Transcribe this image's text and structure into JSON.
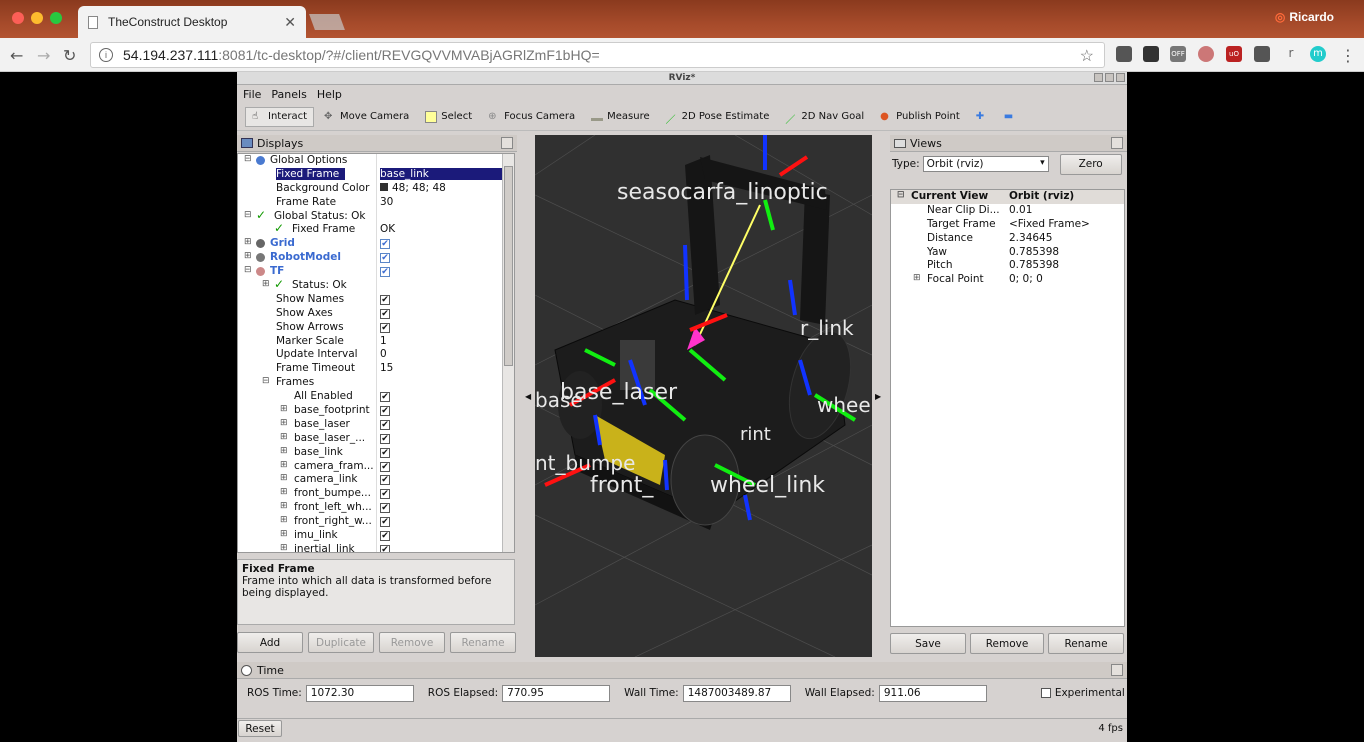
{
  "browser": {
    "tab_title": "TheConstruct Desktop",
    "tab_close": "✕",
    "user": "Ricardo",
    "url_host": "54.194.237.111",
    "url_rest": ":8081/tc-desktop/?#/client/REVGQVVMVABjAGRlZmF1bHQ=",
    "extensions": [
      {
        "label": "OFF"
      },
      {
        "label": "uO"
      },
      {
        "label": "r"
      },
      {
        "label": "m"
      }
    ]
  },
  "rviz": {
    "title": "RViz*",
    "menu": [
      "File",
      "Panels",
      "Help"
    ],
    "tools": [
      "Interact",
      "Move Camera",
      "Select",
      "Focus Camera",
      "Measure",
      "2D Pose Estimate",
      "2D Nav Goal",
      "Publish Point"
    ],
    "displays": {
      "title": "Displays",
      "rows": [
        {
          "k": "Global Options",
          "v": "",
          "i": 0
        },
        {
          "k": "Fixed Frame",
          "v": "base_link",
          "i": 1
        },
        {
          "k": "Background Color",
          "v": "48; 48; 48",
          "i": 1
        },
        {
          "k": "Frame Rate",
          "v": "30",
          "i": 1
        },
        {
          "k": "Global Status: Ok",
          "v": "",
          "i": 0
        },
        {
          "k": "Fixed Frame",
          "v": "OK",
          "i": 1
        },
        {
          "k": "Grid",
          "v": "",
          "i": 0
        },
        {
          "k": "RobotModel",
          "v": "",
          "i": 0
        },
        {
          "k": "TF",
          "v": "",
          "i": 0
        },
        {
          "k": "Status: Ok",
          "v": "",
          "i": 1
        },
        {
          "k": "Show Names",
          "v": "",
          "i": 1
        },
        {
          "k": "Show Axes",
          "v": "",
          "i": 1
        },
        {
          "k": "Show Arrows",
          "v": "",
          "i": 1
        },
        {
          "k": "Marker Scale",
          "v": "1",
          "i": 1
        },
        {
          "k": "Update Interval",
          "v": "0",
          "i": 1
        },
        {
          "k": "Frame Timeout",
          "v": "15",
          "i": 1
        },
        {
          "k": "Frames",
          "v": "",
          "i": 1
        },
        {
          "k": "All Enabled",
          "v": "",
          "i": 2
        },
        {
          "k": "base_footprint",
          "v": "",
          "i": 2
        },
        {
          "k": "base_laser",
          "v": "",
          "i": 2
        },
        {
          "k": "base_laser_...",
          "v": "",
          "i": 2
        },
        {
          "k": "base_link",
          "v": "",
          "i": 2
        },
        {
          "k": "camera_fram...",
          "v": "",
          "i": 2
        },
        {
          "k": "camera_link",
          "v": "",
          "i": 2
        },
        {
          "k": "front_bumpe...",
          "v": "",
          "i": 2
        },
        {
          "k": "front_left_wh...",
          "v": "",
          "i": 2
        },
        {
          "k": "front_right_w...",
          "v": "",
          "i": 2
        },
        {
          "k": "imu_link",
          "v": "",
          "i": 2
        },
        {
          "k": "inertial_link",
          "v": "",
          "i": 2
        }
      ],
      "desc_title": "Fixed Frame",
      "desc_text": "Frame into which all data is transformed before being displayed.",
      "buttons": [
        "Add",
        "Duplicate",
        "Remove",
        "Rename"
      ]
    },
    "scene_labels": [
      "seasocarfa_linoptic",
      "r_link",
      "base_laser",
      "base",
      "wheel_",
      "rint",
      "nt_bumpe",
      "front_",
      "wheel_link"
    ],
    "views": {
      "title": "Views",
      "type_label": "Type:",
      "type_value": "Orbit (rviz)",
      "zero": "Zero",
      "header_k": "Current View",
      "header_v": "Orbit (rviz)",
      "rows": [
        {
          "k": "Near Clip Di...",
          "v": "0.01"
        },
        {
          "k": "Target Frame",
          "v": "<Fixed Frame>"
        },
        {
          "k": "Distance",
          "v": "2.34645"
        },
        {
          "k": "Yaw",
          "v": "0.785398"
        },
        {
          "k": "Pitch",
          "v": "0.785398"
        },
        {
          "k": "Focal Point",
          "v": "0; 0; 0"
        }
      ],
      "buttons": [
        "Save",
        "Remove",
        "Rename"
      ]
    },
    "time": {
      "title": "Time",
      "ros_time_label": "ROS Time:",
      "ros_time": "1072.30",
      "ros_elapsed_label": "ROS Elapsed:",
      "ros_elapsed": "770.95",
      "wall_time_label": "Wall Time:",
      "wall_time": "1487003489.87",
      "wall_elapsed_label": "Wall Elapsed:",
      "wall_elapsed": "911.06",
      "experimental": "Experimental"
    },
    "reset": "Reset",
    "fps": "4 fps"
  }
}
